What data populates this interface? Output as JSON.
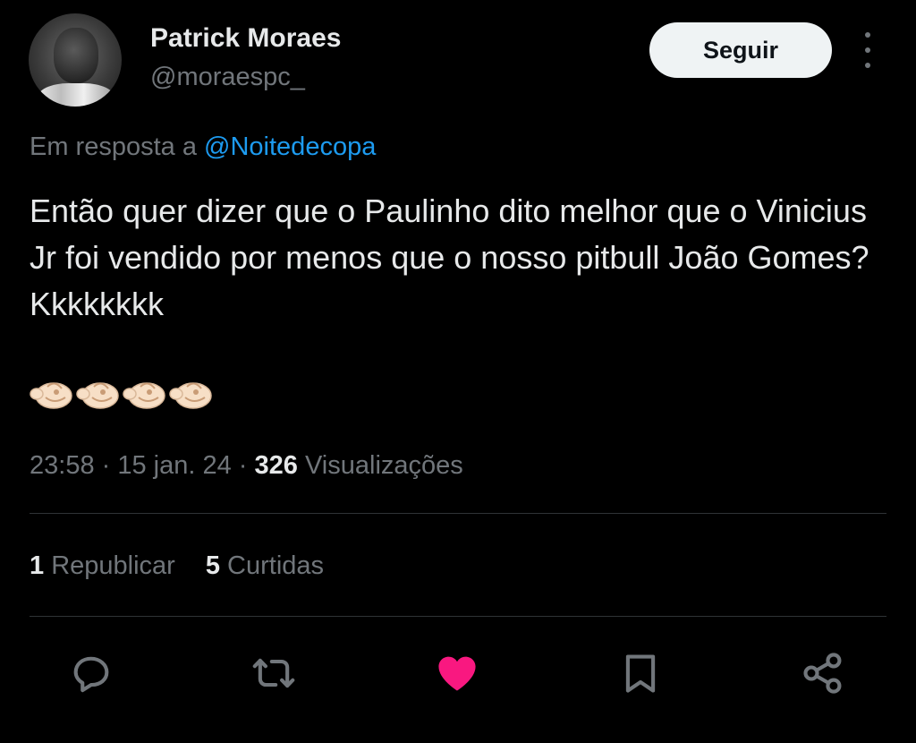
{
  "author": {
    "name": "Patrick Moraes",
    "handle": "@moraespc_"
  },
  "follow_label": "Seguir",
  "reply": {
    "prefix": "Em resposta a",
    "mention": "@Noitedecopa"
  },
  "tweet": {
    "text": "Então quer dizer que o Paulinho dito melhor que o Vinicius Jr foi vendido por menos que o nosso pitbull João Gomes? Kkkkkkkk",
    "emojis": [
      "pinching-hand-icon",
      "pinching-hand-icon",
      "pinching-hand-icon",
      "pinching-hand-icon"
    ]
  },
  "meta": {
    "time": "23:58",
    "sep1": " · ",
    "date": "15 jan. 24",
    "sep2": " · ",
    "views_count": "326",
    "views_label": "Visualizações"
  },
  "stats": {
    "reposts_count": "1",
    "reposts_label": "Republicar",
    "likes_count": "5",
    "likes_label": "Curtidas"
  },
  "actions": [
    "reply-icon",
    "repost-icon",
    "like-icon",
    "bookmark-icon",
    "share-icon"
  ],
  "colors": {
    "background": "#000000",
    "text": "#e7e9ea",
    "muted": "#71767b",
    "link": "#1d9bf0",
    "like": "#f91880"
  }
}
